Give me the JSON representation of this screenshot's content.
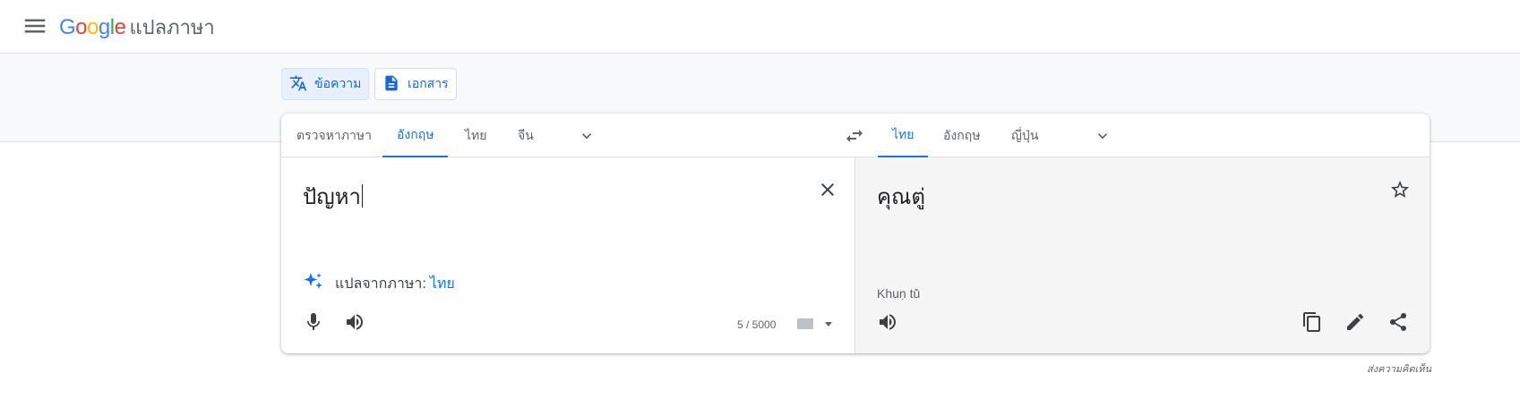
{
  "header": {
    "logo_letters": [
      "G",
      "o",
      "o",
      "g",
      "l",
      "e"
    ],
    "logo_colors": [
      "#4285F4",
      "#EA4335",
      "#FBBC05",
      "#4285F4",
      "#34A853",
      "#EA4335"
    ],
    "product": "แปลภาษา"
  },
  "modes": {
    "text_label": "ข้อความ",
    "document_label": "เอกสาร"
  },
  "source_langs": {
    "tabs": [
      "ตรวจหาภาษา",
      "อังกฤษ",
      "ไทย",
      "จีน"
    ],
    "active_index": 1
  },
  "target_langs": {
    "tabs": [
      "ไทย",
      "อังกฤษ",
      "ญี่ปุ่น"
    ],
    "active_index": 0
  },
  "source": {
    "text": "ปัญหา",
    "detect_prefix": "แปลจากภาษา:",
    "detect_lang": "ไทย",
    "char_count": "5 / 5000"
  },
  "target": {
    "text": "คุณตู่",
    "transliteration": "Khuṇ tū̀"
  },
  "feedback": "ส่งความคิดเห็น",
  "colors": {
    "accent": "#1a73e8",
    "icon": "#5f6368"
  }
}
